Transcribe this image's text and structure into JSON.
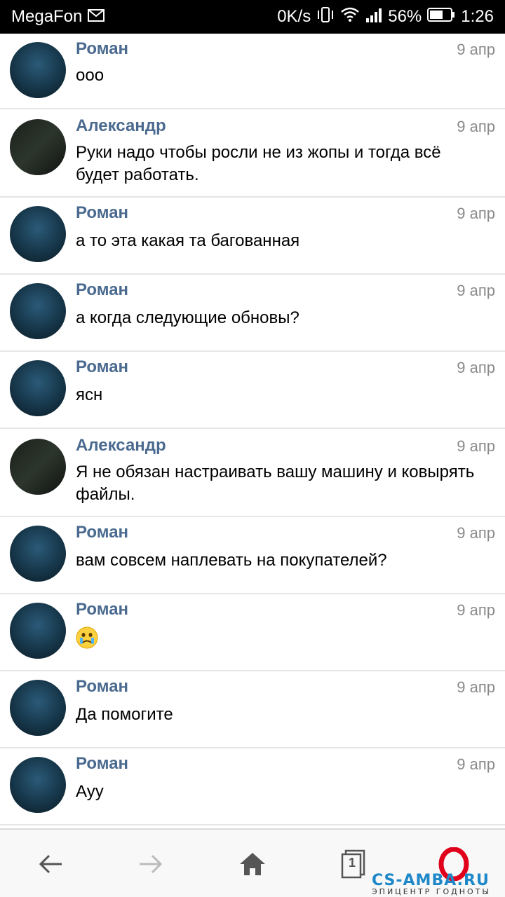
{
  "statusbar": {
    "carrier": "MegaFon",
    "speed": "0K/s",
    "battery": "56%",
    "time": "1:26"
  },
  "messages": [
    {
      "name": "Роман",
      "date": "9 апр",
      "text": "ооо",
      "avatar": "roman-avatar"
    },
    {
      "name": "Александр",
      "date": "9 апр",
      "text": "Руки надо чтобы росли не из жопы и тогда всё будет работать.",
      "avatar": "alexander-avatar"
    },
    {
      "name": "Роман",
      "date": "9 апр",
      "text": "а то эта какая та багованная",
      "avatar": "roman-avatar"
    },
    {
      "name": "Роман",
      "date": "9 апр",
      "text": "а когда следующие обновы?",
      "avatar": "roman-avatar"
    },
    {
      "name": "Роман",
      "date": "9 апр",
      "text": "ясн",
      "avatar": "roman-avatar"
    },
    {
      "name": "Александр",
      "date": "9 апр",
      "text": "Я не обязан настраивать вашу машину и ковырять файлы.",
      "avatar": "alexander-avatar"
    },
    {
      "name": "Роман",
      "date": "9 апр",
      "text": "вам совсем наплевать на покупателей?",
      "avatar": "roman-avatar"
    },
    {
      "name": "Роман",
      "date": "9 апр",
      "text": "",
      "emoji": "crying-emoji",
      "avatar": "roman-avatar"
    },
    {
      "name": "Роман",
      "date": "9 апр",
      "text": "Да помогите",
      "avatar": "roman-avatar"
    },
    {
      "name": "Роман",
      "date": "9 апр",
      "text": "Ауу",
      "avatar": "roman-avatar"
    }
  ],
  "navbar": {
    "back": "arrow-left-icon",
    "forward": "arrow-right-icon",
    "home": "home-icon",
    "tabs_count": "1",
    "browser": "opera-icon"
  },
  "watermark": {
    "title": "CS-AMBA.RU",
    "subtitle": "ЭПИЦЕНТР ГОДНОТЫ"
  },
  "colors": {
    "name": "#4a6a8f",
    "date": "#8a8a8a",
    "divider": "#e6e6e6",
    "opera": "#e0001b",
    "watermark": "#1e88c8"
  }
}
